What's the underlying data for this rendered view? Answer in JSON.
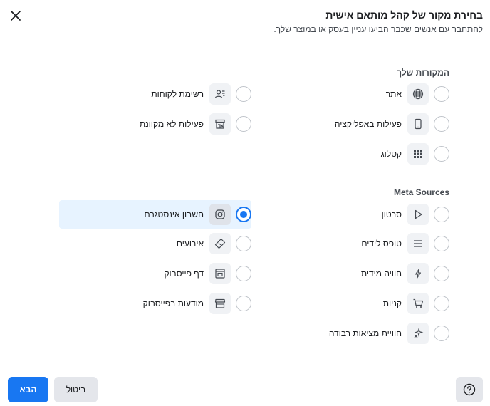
{
  "dialog": {
    "title": "בחירת מקור של קהל מותאם אישית",
    "subtitle": "להתחבר עם אנשים שכבר הביעו עניין בעסק או במוצר שלך."
  },
  "sections": {
    "your_sources_title": "המקורות שלך",
    "meta_sources_title": "Meta Sources"
  },
  "your_sources": {
    "right": [
      {
        "label": "אתר",
        "icon": "globe-icon"
      },
      {
        "label": "פעילות באפליקציה",
        "icon": "mobile-icon"
      },
      {
        "label": "קטלוג",
        "icon": "grid-icon"
      }
    ],
    "left": [
      {
        "label": "רשימת לקוחות",
        "icon": "customer-list-icon"
      },
      {
        "label": "פעילות לא מקוונת",
        "icon": "store-icon"
      }
    ]
  },
  "meta_sources": {
    "right": [
      {
        "label": "סרטון",
        "icon": "play-icon"
      },
      {
        "label": "טופס לידים",
        "icon": "form-lines-icon"
      },
      {
        "label": "חוויה מידית",
        "icon": "lightning-icon"
      },
      {
        "label": "קניות",
        "icon": "cart-icon"
      },
      {
        "label": "חוויית מציאות רבודה",
        "icon": "sparkle-icon"
      }
    ],
    "left": [
      {
        "label": "חשבון אינסטגרם",
        "icon": "instagram-icon",
        "selected": true
      },
      {
        "label": "אירועים",
        "icon": "ticket-icon"
      },
      {
        "label": "דף פייסבוק",
        "icon": "page-icon"
      },
      {
        "label": "מודעות בפייסבוק",
        "icon": "shop-icon"
      }
    ]
  },
  "footer": {
    "next_label": "הבא",
    "cancel_label": "ביטול"
  },
  "colors": {
    "accent": "#1877f2",
    "selected_bg": "#e7f3ff",
    "icon_bg": "#f0f2f5"
  }
}
